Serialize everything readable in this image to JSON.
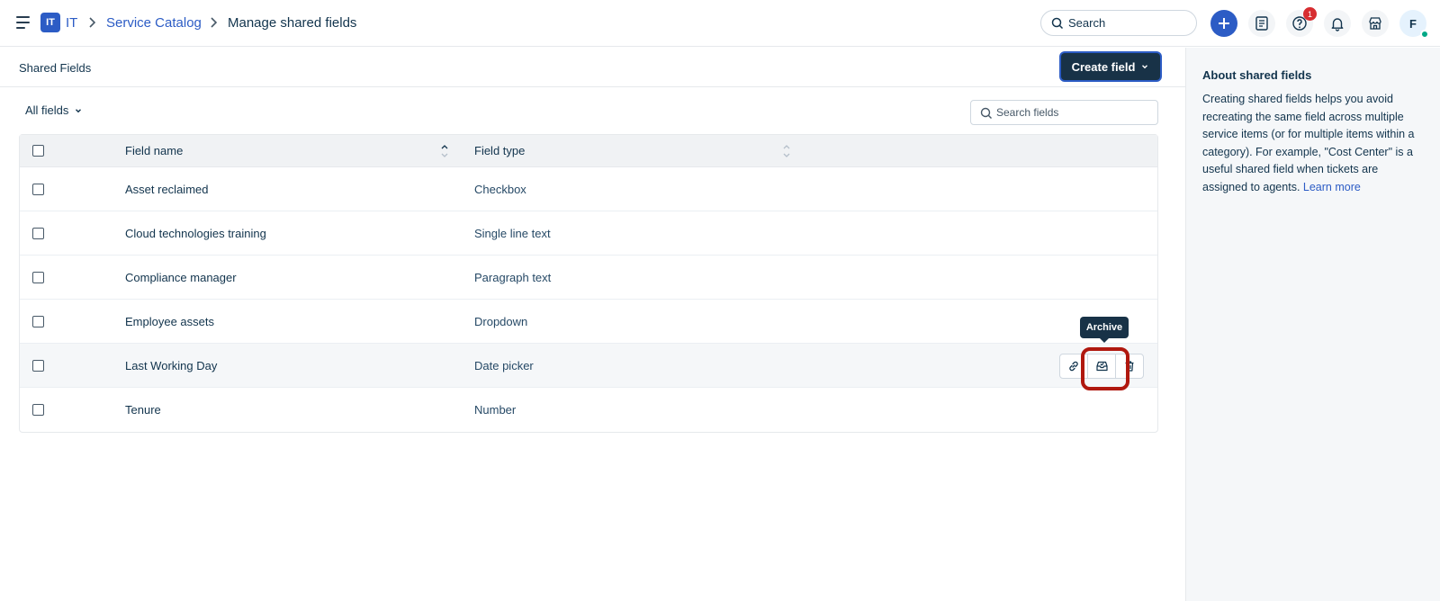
{
  "header": {
    "workspace_badge": "IT",
    "workspace_name": "IT",
    "breadcrumb_link": "Service Catalog",
    "breadcrumb_current": "Manage shared fields",
    "search_placeholder": "Search",
    "notification_count": "1",
    "avatar_initial": "F"
  },
  "toolbar": {
    "title": "Shared Fields",
    "create_label": "Create field"
  },
  "filters": {
    "view_label": "All fields",
    "search_placeholder": "Search fields"
  },
  "table": {
    "columns": [
      "Field name",
      "Field type"
    ],
    "rows": [
      {
        "name": "Asset reclaimed",
        "type": "Checkbox"
      },
      {
        "name": "Cloud technologies training",
        "type": "Single line text"
      },
      {
        "name": "Compliance manager",
        "type": "Paragraph text"
      },
      {
        "name": "Employee assets",
        "type": "Dropdown"
      },
      {
        "name": "Last Working Day",
        "type": "Date picker"
      },
      {
        "name": "Tenure",
        "type": "Number"
      }
    ],
    "tooltip": "Archive"
  },
  "side_panel": {
    "title": "About shared fields",
    "body": "Creating shared fields helps you avoid recreating the same field across multiple service items (or for multiple items within a category). For example, \"Cost Center\" is a useful shared field when tickets are assigned to agents.",
    "link": "Learn more"
  },
  "colors": {
    "accent": "#2c5cc5",
    "primary_dark": "#183247",
    "highlight_ring": "#b0180f"
  }
}
